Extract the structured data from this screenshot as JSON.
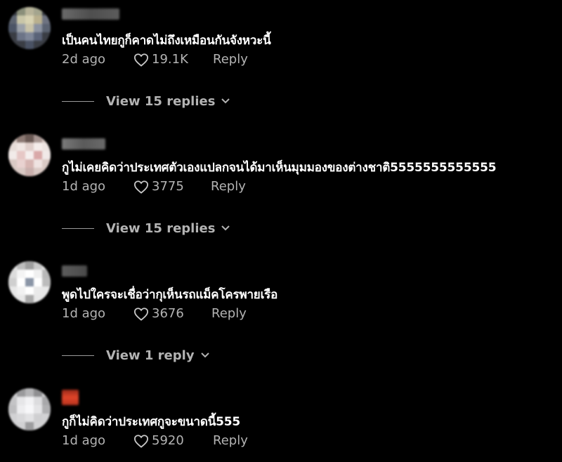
{
  "comments": [
    {
      "text": "เป็นคนไทยกูก็คาดไม่ถึงเหมือนกันจังหวะนี้",
      "date": "2d ago",
      "likes": "19.1K",
      "reply_label": "Reply",
      "view_replies": "View 15 replies"
    },
    {
      "text": "กูไม่เคยคิดว่าประเทศตัวเองแปลกจนได้มาเห็นมุมมองของต่างชาติ5555555555555",
      "date": "1d ago",
      "likes": "3775",
      "reply_label": "Reply",
      "view_replies": "View 15 replies"
    },
    {
      "text": "พูดไปใครจะเชื่อว่ากุเห็นรถแม็คโครพายเรือ",
      "date": "1d ago",
      "likes": "3676",
      "reply_label": "Reply",
      "view_replies": "View 1 reply"
    },
    {
      "text": "กูก็ไม่คิดว่าประเทศกูจะขนาดนี้555",
      "date": "1d ago",
      "likes": "5920",
      "reply_label": "Reply"
    }
  ],
  "icons": {
    "like": "heart-icon",
    "expand": "chevron-down-icon"
  },
  "colors": {
    "background": "#000000",
    "text_primary": "#ffffff",
    "text_secondary": "#b3b3b3"
  }
}
